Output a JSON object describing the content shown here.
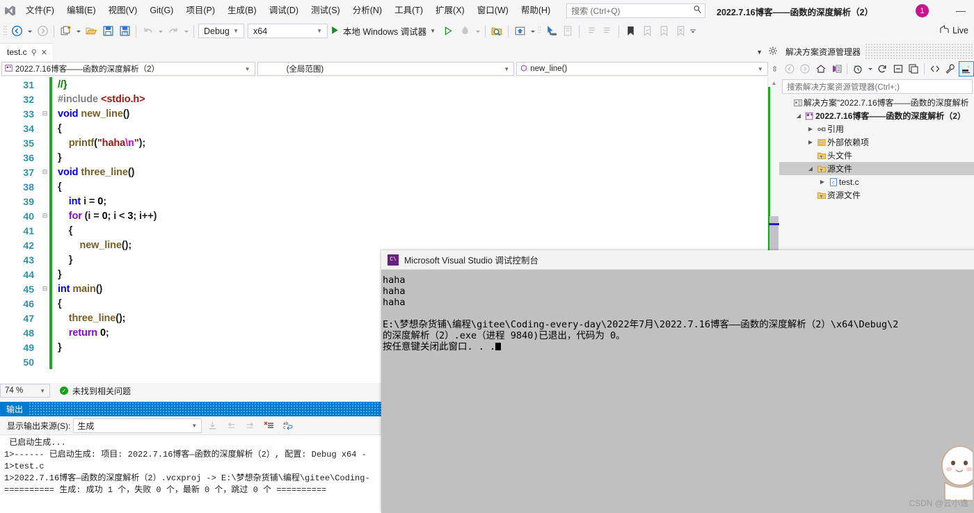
{
  "window": {
    "title": "2022.7.16博客——函数的深度解析（2）",
    "avatar_badge": "1",
    "minimize_label": "—",
    "live_share_label": "Live"
  },
  "menu": {
    "items": [
      {
        "label": "文件(F)",
        "name": "menu-file"
      },
      {
        "label": "编辑(E)",
        "name": "menu-edit"
      },
      {
        "label": "视图(V)",
        "name": "menu-view"
      },
      {
        "label": "Git(G)",
        "name": "menu-git"
      },
      {
        "label": "项目(P)",
        "name": "menu-project"
      },
      {
        "label": "生成(B)",
        "name": "menu-build"
      },
      {
        "label": "调试(D)",
        "name": "menu-debug"
      },
      {
        "label": "测试(S)",
        "name": "menu-test"
      },
      {
        "label": "分析(N)",
        "name": "menu-analyze"
      },
      {
        "label": "工具(T)",
        "name": "menu-tools"
      },
      {
        "label": "扩展(X)",
        "name": "menu-extensions"
      },
      {
        "label": "窗口(W)",
        "name": "menu-window"
      },
      {
        "label": "帮助(H)",
        "name": "menu-help"
      }
    ]
  },
  "search": {
    "placeholder": "搜索 (Ctrl+Q)",
    "icon": "search-icon"
  },
  "toolbar": {
    "config_value": "Debug",
    "platform_value": "x64",
    "run_label": "本地 Windows 调试器"
  },
  "editor": {
    "tab_label": "test.c",
    "tab_pin": "⚲",
    "tab_close": "✕",
    "nav_project": "2022.7.16博客——函数的深度解析（2）",
    "nav_scope": "(全局范围)",
    "nav_member": "new_line()",
    "zoom_level": "74 %",
    "issue_status": "未找到相关问题",
    "lines": [
      {
        "n": "31",
        "fold": "",
        "tokens": [
          {
            "t": "//}",
            "c": "cmt"
          }
        ],
        "indent": 0
      },
      {
        "n": "32",
        "fold": "",
        "tokens": [
          {
            "t": "#include ",
            "c": "pp"
          },
          {
            "t": "<stdio.h>",
            "c": "inc"
          }
        ],
        "indent": 0
      },
      {
        "n": "33",
        "fold": "−",
        "tokens": [
          {
            "t": "void",
            "c": "kw"
          },
          {
            "t": " ",
            "c": "pl"
          },
          {
            "t": "new_line",
            "c": "fn"
          },
          {
            "t": "()",
            "c": "pl"
          }
        ],
        "indent": 0
      },
      {
        "n": "34",
        "fold": "",
        "tokens": [
          {
            "t": "{",
            "c": "pl"
          }
        ],
        "indent": 0
      },
      {
        "n": "35",
        "fold": "",
        "tokens": [
          {
            "t": "    ",
            "c": "pl"
          },
          {
            "t": "printf",
            "c": "fn"
          },
          {
            "t": "(",
            "c": "pl"
          },
          {
            "t": "\"haha",
            "c": "str"
          },
          {
            "t": "\\n",
            "c": "esc"
          },
          {
            "t": "\"",
            "c": "str"
          },
          {
            "t": ");",
            "c": "pl"
          }
        ],
        "indent": 1
      },
      {
        "n": "36",
        "fold": "",
        "tokens": [
          {
            "t": "}",
            "c": "pl"
          }
        ],
        "indent": 0
      },
      {
        "n": "37",
        "fold": "−",
        "tokens": [
          {
            "t": "void",
            "c": "kw"
          },
          {
            "t": " ",
            "c": "pl"
          },
          {
            "t": "three_line",
            "c": "fn"
          },
          {
            "t": "()",
            "c": "pl"
          }
        ],
        "indent": 0
      },
      {
        "n": "38",
        "fold": "",
        "tokens": [
          {
            "t": "{",
            "c": "pl"
          }
        ],
        "indent": 0
      },
      {
        "n": "39",
        "fold": "",
        "tokens": [
          {
            "t": "    ",
            "c": "pl"
          },
          {
            "t": "int",
            "c": "kw"
          },
          {
            "t": " i = ",
            "c": "pl"
          },
          {
            "t": "0",
            "c": "num"
          },
          {
            "t": ";",
            "c": "pl"
          }
        ],
        "indent": 1
      },
      {
        "n": "40",
        "fold": "−",
        "tokens": [
          {
            "t": "    ",
            "c": "pl"
          },
          {
            "t": "for",
            "c": "kw2"
          },
          {
            "t": " (i = ",
            "c": "pl"
          },
          {
            "t": "0",
            "c": "num"
          },
          {
            "t": "; i < ",
            "c": "pl"
          },
          {
            "t": "3",
            "c": "num"
          },
          {
            "t": "; i++)",
            "c": "pl"
          }
        ],
        "indent": 1
      },
      {
        "n": "41",
        "fold": "",
        "tokens": [
          {
            "t": "    {",
            "c": "pl"
          }
        ],
        "indent": 1
      },
      {
        "n": "42",
        "fold": "",
        "tokens": [
          {
            "t": "        ",
            "c": "pl"
          },
          {
            "t": "new_line",
            "c": "fn"
          },
          {
            "t": "();",
            "c": "pl"
          }
        ],
        "indent": 2
      },
      {
        "n": "43",
        "fold": "",
        "tokens": [
          {
            "t": "    }",
            "c": "pl"
          }
        ],
        "indent": 1
      },
      {
        "n": "44",
        "fold": "",
        "tokens": [
          {
            "t": "}",
            "c": "pl"
          }
        ],
        "indent": 0
      },
      {
        "n": "45",
        "fold": "−",
        "tokens": [
          {
            "t": "int",
            "c": "kw"
          },
          {
            "t": " ",
            "c": "pl"
          },
          {
            "t": "main",
            "c": "fn"
          },
          {
            "t": "()",
            "c": "pl"
          }
        ],
        "indent": 0
      },
      {
        "n": "46",
        "fold": "",
        "tokens": [
          {
            "t": "{",
            "c": "pl"
          }
        ],
        "indent": 0
      },
      {
        "n": "47",
        "fold": "",
        "tokens": [
          {
            "t": "    ",
            "c": "pl"
          },
          {
            "t": "three_line",
            "c": "fn"
          },
          {
            "t": "();",
            "c": "pl"
          }
        ],
        "indent": 1
      },
      {
        "n": "48",
        "fold": "",
        "tokens": [
          {
            "t": "    ",
            "c": "pl"
          },
          {
            "t": "return",
            "c": "kw2"
          },
          {
            "t": " ",
            "c": "pl"
          },
          {
            "t": "0",
            "c": "num"
          },
          {
            "t": ";",
            "c": "pl"
          }
        ],
        "indent": 1
      },
      {
        "n": "49",
        "fold": "",
        "tokens": [
          {
            "t": "}",
            "c": "pl"
          }
        ],
        "indent": 0
      },
      {
        "n": "50",
        "fold": "",
        "tokens": [],
        "indent": 0
      }
    ]
  },
  "output_panel": {
    "title": "输出",
    "source_label": "显示输出来源(S):",
    "source_value": "生成",
    "lines": [
      " 已启动生成...",
      "1>------ 已启动生成: 项目: 2022.7.16博客—函数的深度解析（2）, 配置: Debug x64 -",
      "1>test.c",
      "1>2022.7.16博客—函数的深度解析（2）.vcxproj -> E:\\梦想杂货铺\\编程\\gitee\\Coding-",
      "========== 生成: 成功 1 个，失败 0 个，最新 0 个，跳过 0 个 =========="
    ]
  },
  "solution_explorer": {
    "title": "解决方案资源管理器",
    "search_placeholder": "搜索解决方案资源管理器(Ctrl+;)",
    "tree": [
      {
        "indent": 0,
        "arrow": "",
        "icon": "solution-icon",
        "label": "解决方案\"2022.7.16博客——函数的深度解析",
        "bold": false,
        "selected": false,
        "name": "tree-item-solution"
      },
      {
        "indent": 1,
        "arrow": "▲",
        "icon": "project-icon",
        "label": "2022.7.16博客——函数的深度解析（2）",
        "bold": true,
        "selected": false,
        "name": "tree-item-project"
      },
      {
        "indent": 2,
        "arrow": "▶",
        "icon": "references-icon",
        "label": "引用",
        "bold": false,
        "selected": false,
        "name": "tree-item-references"
      },
      {
        "indent": 2,
        "arrow": "▶",
        "icon": "external-deps-icon",
        "label": "外部依赖项",
        "bold": false,
        "selected": false,
        "name": "tree-item-external-dependencies"
      },
      {
        "indent": 2,
        "arrow": "",
        "icon": "folder-filter-icon",
        "label": "头文件",
        "bold": false,
        "selected": false,
        "name": "tree-item-header-files"
      },
      {
        "indent": 2,
        "arrow": "▲",
        "icon": "folder-filter-icon",
        "label": "源文件",
        "bold": false,
        "selected": true,
        "name": "tree-item-source-files"
      },
      {
        "indent": 3,
        "arrow": "▶",
        "icon": "c-file-icon",
        "label": "test.c",
        "bold": false,
        "selected": false,
        "name": "tree-item-test-c"
      },
      {
        "indent": 2,
        "arrow": "",
        "icon": "folder-filter-icon",
        "label": "资源文件",
        "bold": false,
        "selected": false,
        "name": "tree-item-resource-files"
      }
    ]
  },
  "console": {
    "title": "Microsoft Visual Studio 调试控制台",
    "icon_label": "C\\",
    "lines": [
      "haha",
      "haha",
      "haha",
      "",
      "E:\\梦想杂货铺\\编程\\gitee\\Coding-every-day\\2022年7月\\2022.7.16博客——函数的深度解析（2）\\x64\\Debug\\2",
      "的深度解析（2）.exe（进程 9840)已退出，代码为 0。",
      "按任意键关闭此窗口. . ."
    ]
  },
  "watermark": {
    "text": "CSDN @云小逸"
  },
  "colors": {
    "accent_blue": "#007acc",
    "change_bar_green": "#23a32a",
    "keyword_blue": "#0000ff",
    "string_red": "#a31515",
    "comment_green": "#008000",
    "function_brown": "#795e26",
    "avatar_magenta": "#c6168d"
  }
}
